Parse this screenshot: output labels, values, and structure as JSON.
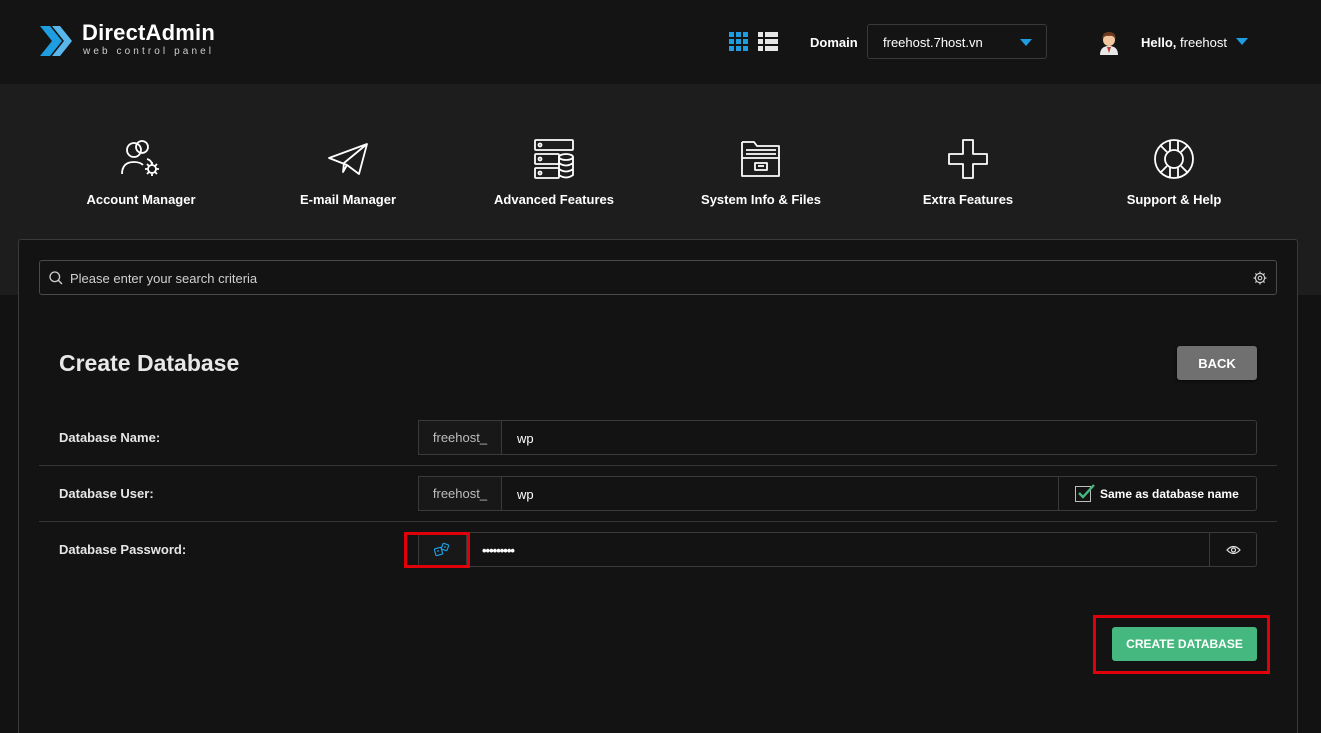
{
  "header": {
    "logo_title": "DirectAdmin",
    "logo_subtitle": "web control panel",
    "domain_label": "Domain",
    "domain_value": "freehost.7host.vn",
    "greeting": "Hello,",
    "username": "freehost"
  },
  "nav": {
    "items": [
      {
        "label": "Account Manager",
        "icon": "account-manager-icon"
      },
      {
        "label": "E-mail Manager",
        "icon": "paper-plane-icon"
      },
      {
        "label": "Advanced Features",
        "icon": "server-database-icon"
      },
      {
        "label": "System Info & Files",
        "icon": "folder-icon"
      },
      {
        "label": "Extra Features",
        "icon": "plus-icon"
      },
      {
        "label": "Support & Help",
        "icon": "lifebuoy-icon"
      }
    ]
  },
  "search": {
    "placeholder": "Please enter your search criteria"
  },
  "page": {
    "title": "Create Database",
    "back_label": "BACK"
  },
  "form": {
    "db_name_label": "Database Name:",
    "db_name_prefix": "freehost_",
    "db_name_value": "wp",
    "db_user_label": "Database User:",
    "db_user_prefix": "freehost_",
    "db_user_value": "wp",
    "same_as_label": "Same as database name",
    "same_as_checked": true,
    "db_password_label": "Database Password:",
    "db_password_value": "•••••••••",
    "submit_label": "CREATE DATABASE"
  },
  "colors": {
    "accent": "#1e9de0",
    "create_button": "#45b87f",
    "back_button": "#707070",
    "highlight": "#e0000a"
  }
}
